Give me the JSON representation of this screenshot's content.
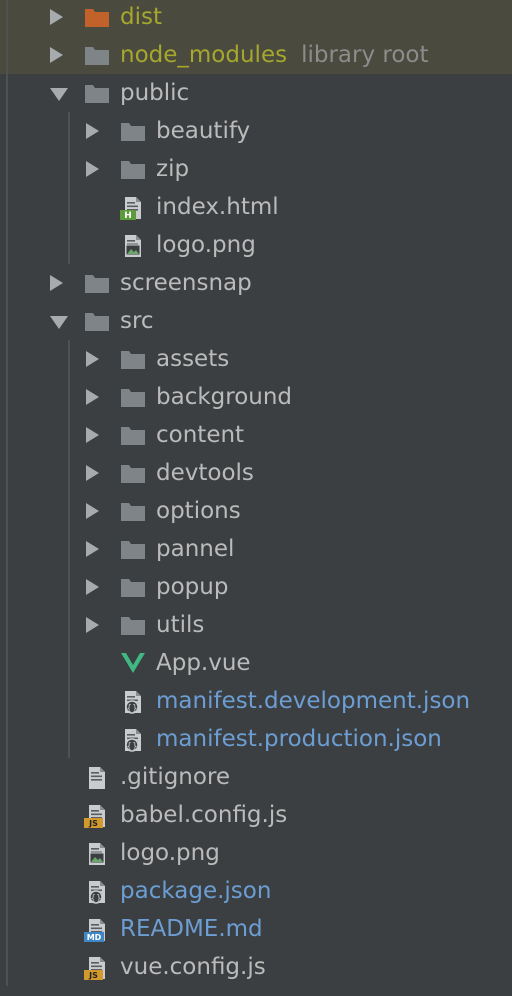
{
  "colors": {
    "background": "#3c3f41",
    "highlight": "#4b4a3e",
    "text": "#bbbbbb",
    "modified_blue": "#6c9ed4",
    "excluded_olive": "#a6a72d",
    "folder_gray": "#7f8488",
    "excluded_folder": "#c2622a",
    "vue_green": "#41b883"
  },
  "tree": {
    "rows": [
      {
        "label": "dist",
        "icon": "folder-excluded-icon",
        "expander": "right",
        "depth": 1,
        "style": "olive",
        "highlight": true
      },
      {
        "label": "node_modules",
        "suffix": "library root",
        "icon": "folder-icon",
        "expander": "right",
        "depth": 1,
        "style": "olive",
        "highlight": true
      },
      {
        "label": "public",
        "icon": "folder-icon",
        "expander": "down",
        "depth": 1,
        "style": "normal"
      },
      {
        "label": "beautify",
        "icon": "folder-icon",
        "expander": "right",
        "depth": 2,
        "style": "normal"
      },
      {
        "label": "zip",
        "icon": "folder-icon",
        "expander": "right",
        "depth": 2,
        "style": "normal"
      },
      {
        "label": "index.html",
        "icon": "html-file-icon",
        "expander": "none",
        "depth": 2,
        "style": "normal"
      },
      {
        "label": "logo.png",
        "icon": "image-file-icon",
        "expander": "none",
        "depth": 2,
        "style": "normal"
      },
      {
        "label": "screensnap",
        "icon": "folder-icon",
        "expander": "right",
        "depth": 1,
        "style": "normal"
      },
      {
        "label": "src",
        "icon": "folder-icon",
        "expander": "down",
        "depth": 1,
        "style": "normal"
      },
      {
        "label": "assets",
        "icon": "folder-icon",
        "expander": "right",
        "depth": 2,
        "style": "normal"
      },
      {
        "label": "background",
        "icon": "folder-icon",
        "expander": "right",
        "depth": 2,
        "style": "normal"
      },
      {
        "label": "content",
        "icon": "folder-icon",
        "expander": "right",
        "depth": 2,
        "style": "normal"
      },
      {
        "label": "devtools",
        "icon": "folder-icon",
        "expander": "right",
        "depth": 2,
        "style": "normal"
      },
      {
        "label": "options",
        "icon": "folder-icon",
        "expander": "right",
        "depth": 2,
        "style": "normal"
      },
      {
        "label": "pannel",
        "icon": "folder-icon",
        "expander": "right",
        "depth": 2,
        "style": "normal"
      },
      {
        "label": "popup",
        "icon": "folder-icon",
        "expander": "right",
        "depth": 2,
        "style": "normal"
      },
      {
        "label": "utils",
        "icon": "folder-icon",
        "expander": "right",
        "depth": 2,
        "style": "normal"
      },
      {
        "label": "App.vue",
        "icon": "vue-file-icon",
        "expander": "none",
        "depth": 2,
        "style": "normal"
      },
      {
        "label": "manifest.development.json",
        "icon": "json-file-icon",
        "expander": "none",
        "depth": 2,
        "style": "blue"
      },
      {
        "label": "manifest.production.json",
        "icon": "json-file-icon",
        "expander": "none",
        "depth": 2,
        "style": "blue"
      },
      {
        "label": ".gitignore",
        "icon": "text-file-icon",
        "expander": "none",
        "depth": 1,
        "style": "normal"
      },
      {
        "label": "babel.config.js",
        "icon": "js-file-icon",
        "expander": "none",
        "depth": 1,
        "style": "normal"
      },
      {
        "label": "logo.png",
        "icon": "image-file-icon",
        "expander": "none",
        "depth": 1,
        "style": "normal"
      },
      {
        "label": "package.json",
        "icon": "json-file-icon",
        "expander": "none",
        "depth": 1,
        "style": "blue"
      },
      {
        "label": "README.md",
        "icon": "md-file-icon",
        "expander": "none",
        "depth": 1,
        "style": "blue"
      },
      {
        "label": "vue.config.js",
        "icon": "js-file-icon",
        "expander": "none",
        "depth": 1,
        "style": "normal"
      }
    ]
  }
}
